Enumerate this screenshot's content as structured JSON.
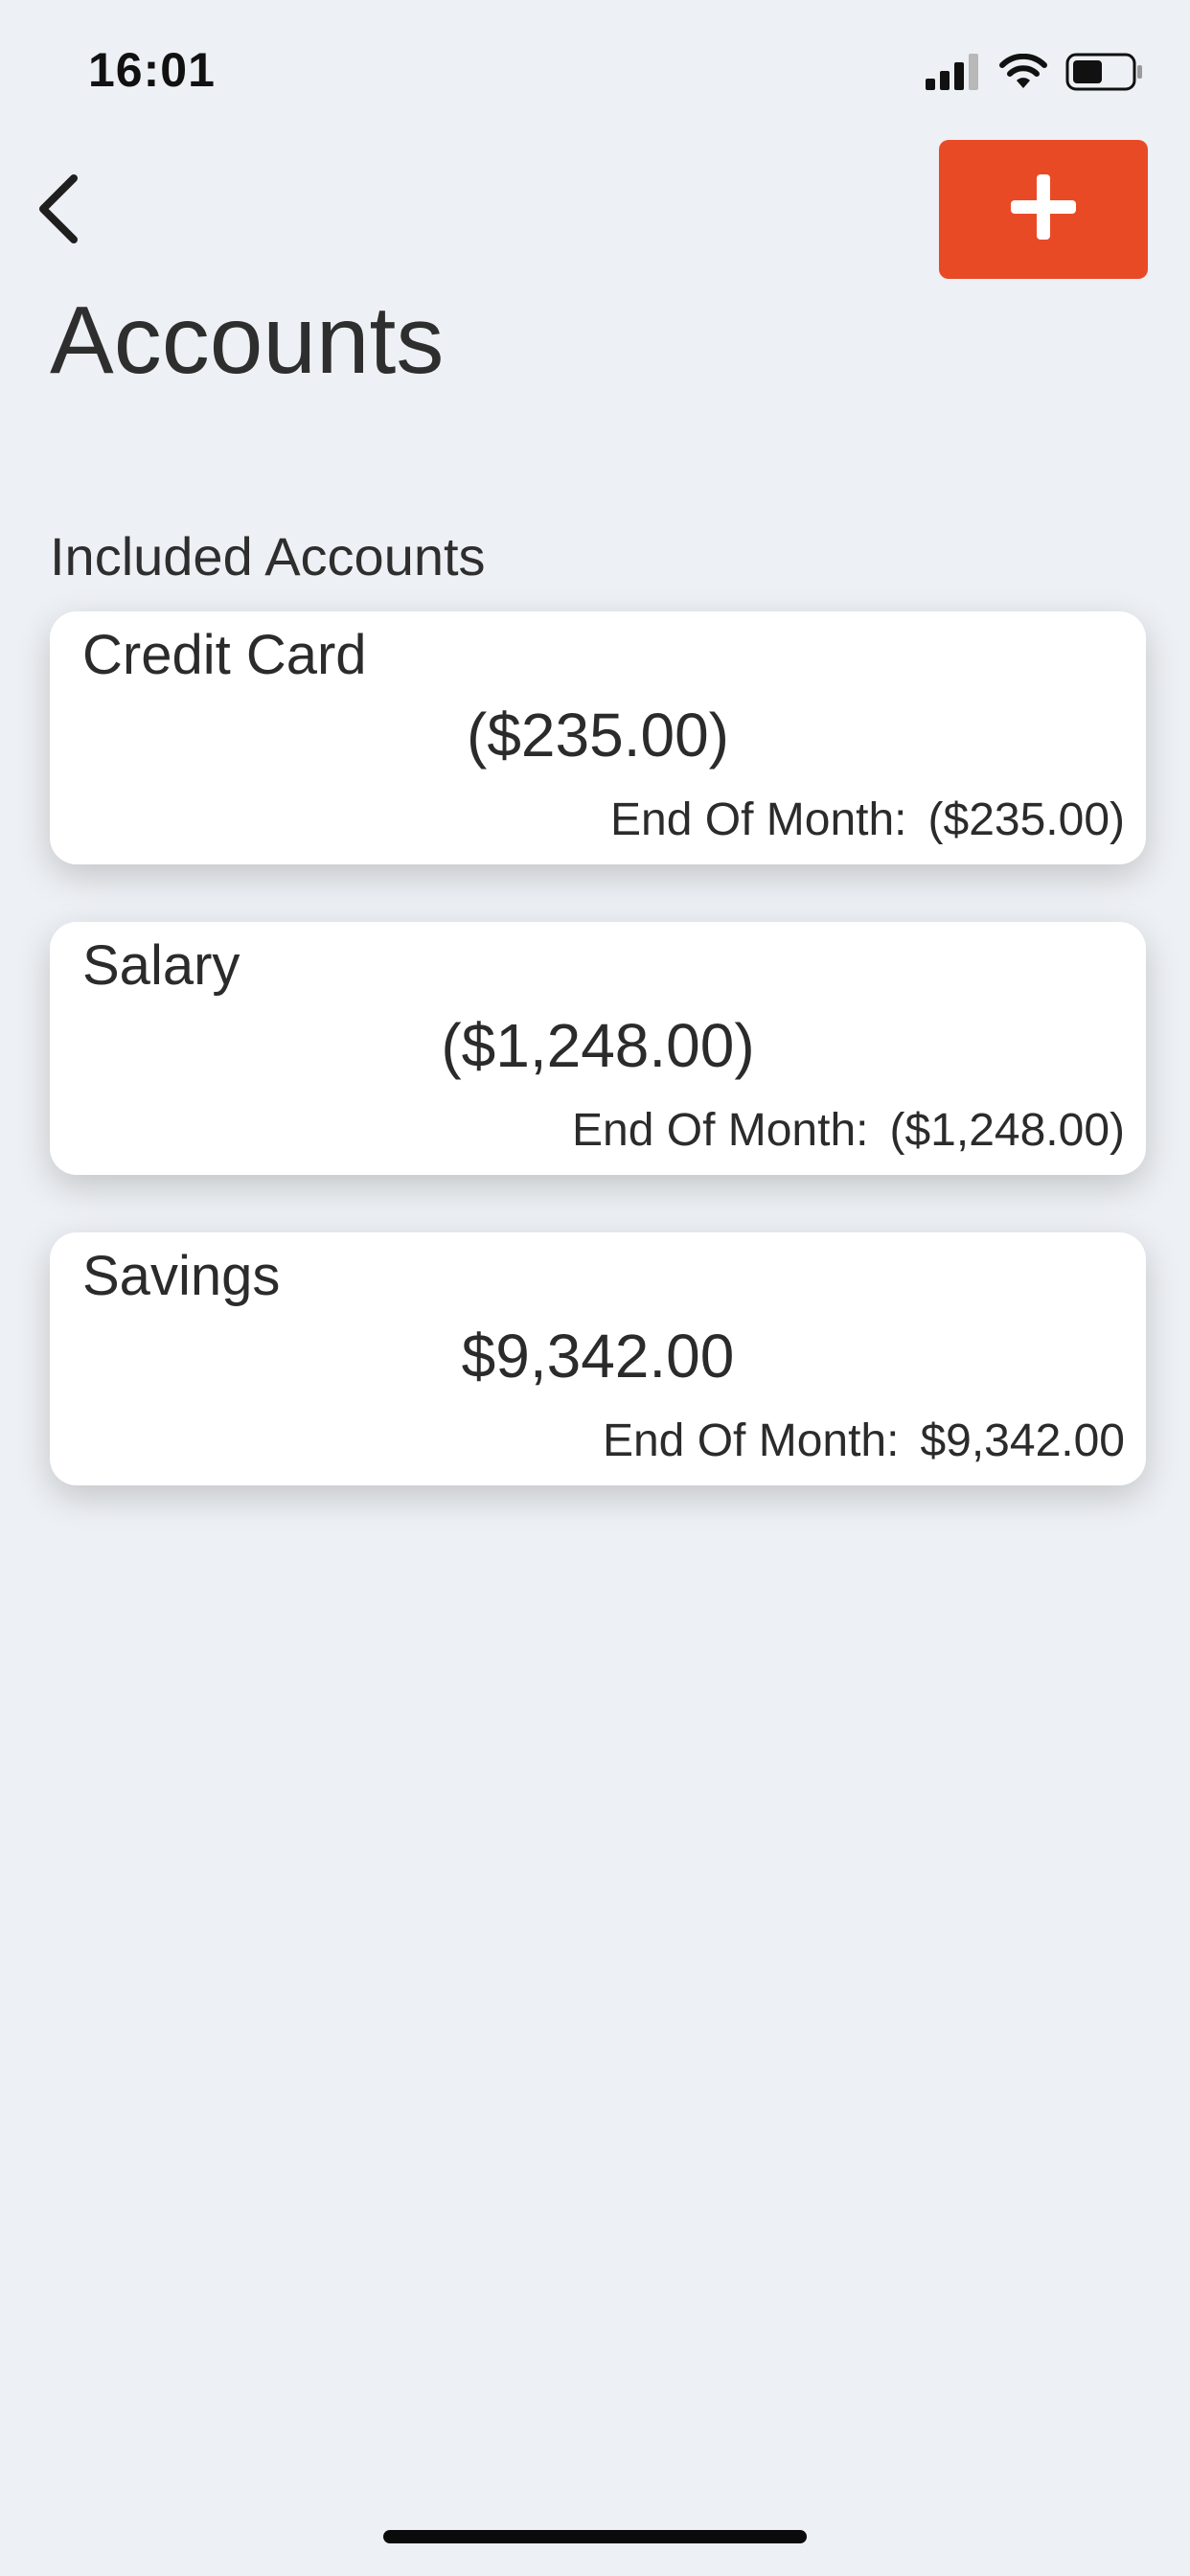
{
  "status_bar": {
    "time": "16:01",
    "icons": [
      "signal-icon",
      "wifi-icon",
      "battery-icon"
    ]
  },
  "nav": {
    "back_icon": "chevron-left-icon",
    "add_icon": "plus-icon",
    "add_button_color": "#e94a26"
  },
  "page": {
    "title": "Accounts"
  },
  "section": {
    "header": "Included Accounts"
  },
  "accounts": [
    {
      "name": "Credit Card",
      "balance": "($235.00)",
      "eom_label": "End Of Month:",
      "eom_value": "($235.00)"
    },
    {
      "name": "Salary",
      "balance": "($1,248.00)",
      "eom_label": "End Of Month:",
      "eom_value": "($1,248.00)"
    },
    {
      "name": "Savings",
      "balance": "$9,342.00",
      "eom_label": "End Of Month:",
      "eom_value": "$9,342.00"
    }
  ]
}
